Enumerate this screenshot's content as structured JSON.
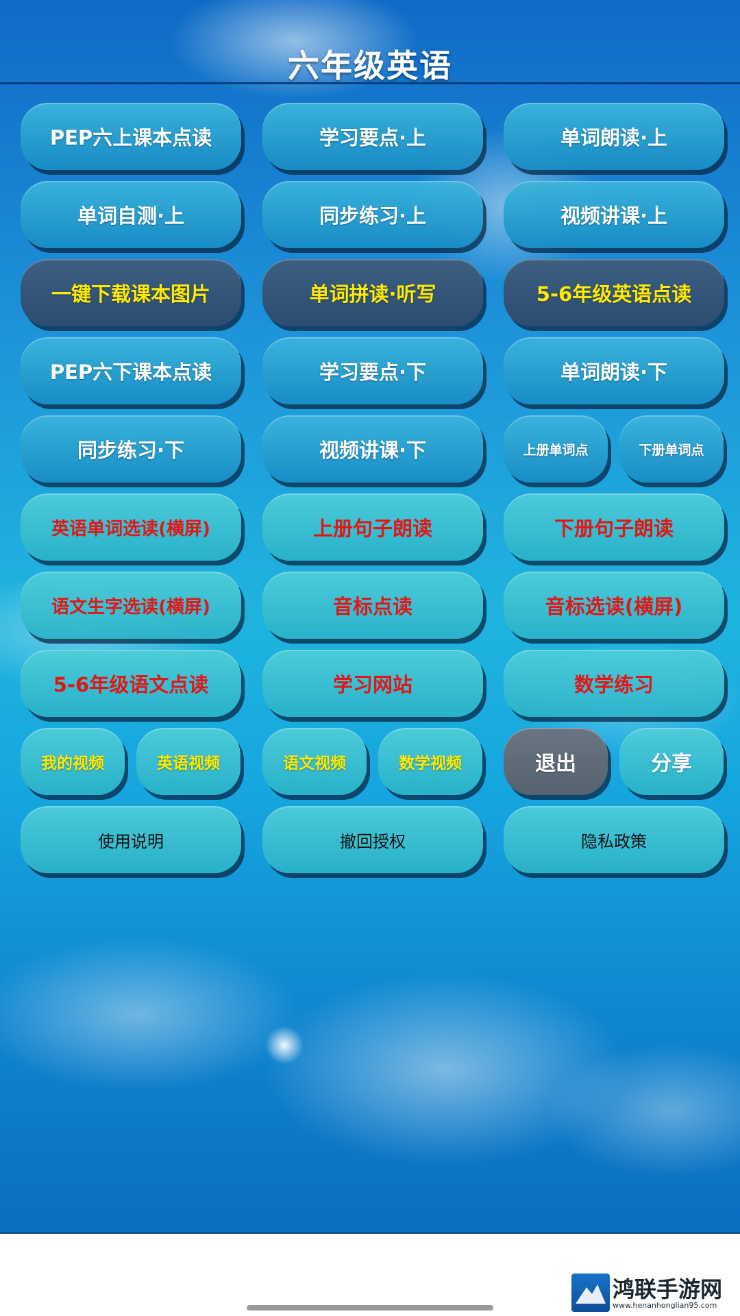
{
  "header": {
    "title": "六年级英语"
  },
  "colors": {
    "sky_top": "#0f6ac6",
    "sky_mid": "#1fb4de",
    "button": "#1e9fd4",
    "highlight_yellow": "#ffea00",
    "highlight_red": "#e31616"
  },
  "rows": [
    [
      "PEP六上课本点读",
      "学习要点·上",
      "单词朗读·上"
    ],
    [
      "单词自测·上",
      "同步练习·上",
      "视频讲课·上"
    ],
    [
      "一键下载课本图片",
      "单词拼读·听写",
      "5-6年级英语点读"
    ],
    [
      "PEP六下课本点读",
      "学习要点·下",
      "单词朗读·下"
    ],
    [
      "同步练习·下",
      "视频讲课·下",
      "上册单词点",
      "下册单词点"
    ],
    [
      "英语单词选读(横屏)",
      "上册句子朗读",
      "下册句子朗读"
    ],
    [
      "语文生字选读(横屏)",
      "音标点读",
      "音标选读(横屏)"
    ],
    [
      "5-6年级语文点读",
      "学习网站",
      "数学练习"
    ],
    [
      "我的视频",
      "英语视频",
      "语文视频",
      "数学视频",
      "退出",
      "分享"
    ],
    [
      "使用说明",
      "撤回授权",
      "隐私政策"
    ]
  ],
  "watermark": {
    "name": "鸿联手游网",
    "url": "www.henanhonglian95.com"
  }
}
